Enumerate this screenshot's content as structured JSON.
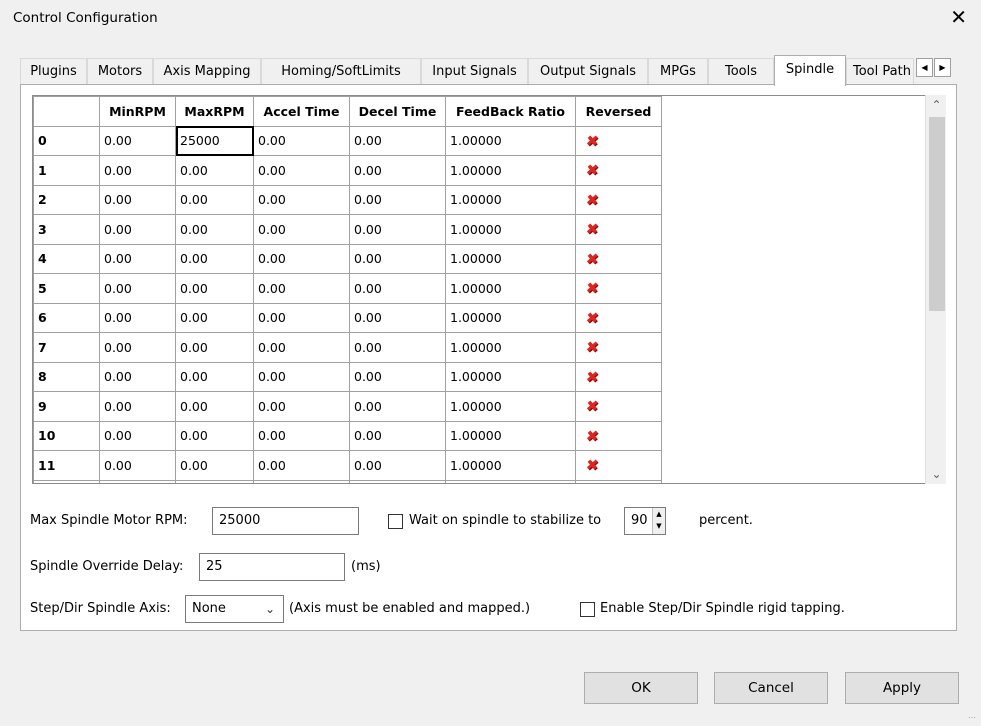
{
  "window": {
    "title": "Control Configuration",
    "close_glyph": "✕"
  },
  "tabs": [
    {
      "label": "Plugins",
      "active": false
    },
    {
      "label": "Motors",
      "active": false
    },
    {
      "label": "Axis Mapping",
      "active": false
    },
    {
      "label": "Homing/SoftLimits",
      "active": false
    },
    {
      "label": "Input Signals",
      "active": false
    },
    {
      "label": "Output Signals",
      "active": false
    },
    {
      "label": "MPGs",
      "active": false
    },
    {
      "label": "Tools",
      "active": false
    },
    {
      "label": "Spindle",
      "active": true
    },
    {
      "label": "Tool Path",
      "active": false
    }
  ],
  "grid": {
    "columns": [
      "MinRPM",
      "MaxRPM",
      "Accel Time",
      "Decel Time",
      "FeedBack Ratio",
      "Reversed"
    ],
    "rows": [
      {
        "id": "0",
        "min": "0.00",
        "max": "25000",
        "accel": "0.00",
        "decel": "0.00",
        "ratio": "1.00000",
        "reversed": false,
        "selected_cell": "max"
      },
      {
        "id": "1",
        "min": "0.00",
        "max": "0.00",
        "accel": "0.00",
        "decel": "0.00",
        "ratio": "1.00000",
        "reversed": false
      },
      {
        "id": "2",
        "min": "0.00",
        "max": "0.00",
        "accel": "0.00",
        "decel": "0.00",
        "ratio": "1.00000",
        "reversed": false
      },
      {
        "id": "3",
        "min": "0.00",
        "max": "0.00",
        "accel": "0.00",
        "decel": "0.00",
        "ratio": "1.00000",
        "reversed": false
      },
      {
        "id": "4",
        "min": "0.00",
        "max": "0.00",
        "accel": "0.00",
        "decel": "0.00",
        "ratio": "1.00000",
        "reversed": false
      },
      {
        "id": "5",
        "min": "0.00",
        "max": "0.00",
        "accel": "0.00",
        "decel": "0.00",
        "ratio": "1.00000",
        "reversed": false
      },
      {
        "id": "6",
        "min": "0.00",
        "max": "0.00",
        "accel": "0.00",
        "decel": "0.00",
        "ratio": "1.00000",
        "reversed": false
      },
      {
        "id": "7",
        "min": "0.00",
        "max": "0.00",
        "accel": "0.00",
        "decel": "0.00",
        "ratio": "1.00000",
        "reversed": false
      },
      {
        "id": "8",
        "min": "0.00",
        "max": "0.00",
        "accel": "0.00",
        "decel": "0.00",
        "ratio": "1.00000",
        "reversed": false
      },
      {
        "id": "9",
        "min": "0.00",
        "max": "0.00",
        "accel": "0.00",
        "decel": "0.00",
        "ratio": "1.00000",
        "reversed": false
      },
      {
        "id": "10",
        "min": "0.00",
        "max": "0.00",
        "accel": "0.00",
        "decel": "0.00",
        "ratio": "1.00000",
        "reversed": false
      },
      {
        "id": "11",
        "min": "0.00",
        "max": "0.00",
        "accel": "0.00",
        "decel": "0.00",
        "ratio": "1.00000",
        "reversed": false
      }
    ],
    "reversed_icon": "red-x-icon"
  },
  "settings": {
    "max_rpm_label": "Max Spindle Motor RPM:",
    "max_rpm_value": "25000",
    "wait_checkbox_label": "Wait on spindle to stabilize to",
    "wait_checked": false,
    "wait_percent_value": "90",
    "percent_label": "percent.",
    "override_delay_label": "Spindle Override Delay:",
    "override_delay_value": "25",
    "override_delay_unit": "(ms)",
    "stepdir_axis_label": "Step/Dir Spindle Axis:",
    "stepdir_axis_value": "None",
    "stepdir_axis_note": "(Axis must be enabled and mapped.)",
    "rigid_tapping_label": "Enable Step/Dir Spindle rigid tapping.",
    "rigid_tapping_checked": false
  },
  "buttons": {
    "ok": "OK",
    "cancel": "Cancel",
    "apply": "Apply"
  }
}
